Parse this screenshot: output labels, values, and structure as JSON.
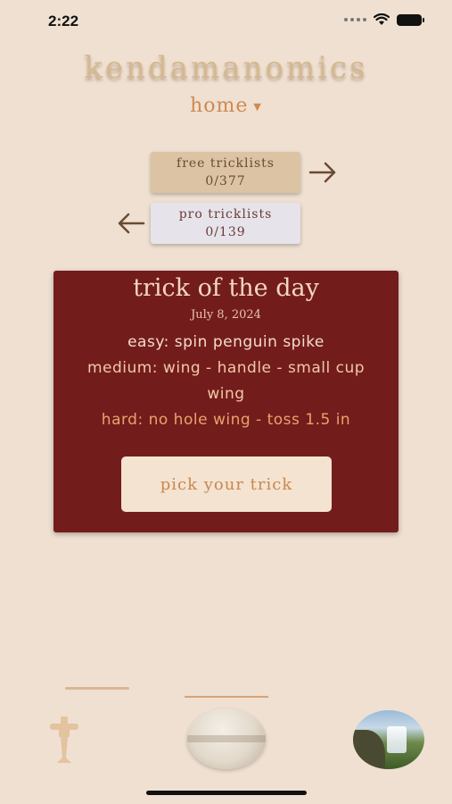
{
  "status_bar": {
    "time": "2:22"
  },
  "app": {
    "title": "kendamanomics"
  },
  "nav": {
    "current": "home"
  },
  "tricklists": {
    "free": {
      "label": "free tricklists",
      "progress": "0/377"
    },
    "pro": {
      "label": "pro tricklists",
      "progress": "0/139"
    }
  },
  "trick_of_the_day": {
    "title": "trick of the day",
    "date": "July 8, 2024",
    "easy": "easy: spin penguin spike",
    "medium": "medium: wing - handle - small cup wing",
    "hard": "hard: no hole wing - toss 1.5 in",
    "pick_button": "pick your trick"
  },
  "colors": {
    "background": "#efe0d1",
    "card": "#731c1c",
    "accent": "#cf8a52",
    "free_button": "#dcc3a3",
    "pro_button": "#e6e4ea"
  },
  "icons": {
    "arrow_right": "arrow-right-icon",
    "arrow_left": "arrow-left-icon",
    "tab_kendama": "kendama-icon",
    "tab_ball": "ball-icon",
    "tab_profile": "profile-avatar"
  }
}
